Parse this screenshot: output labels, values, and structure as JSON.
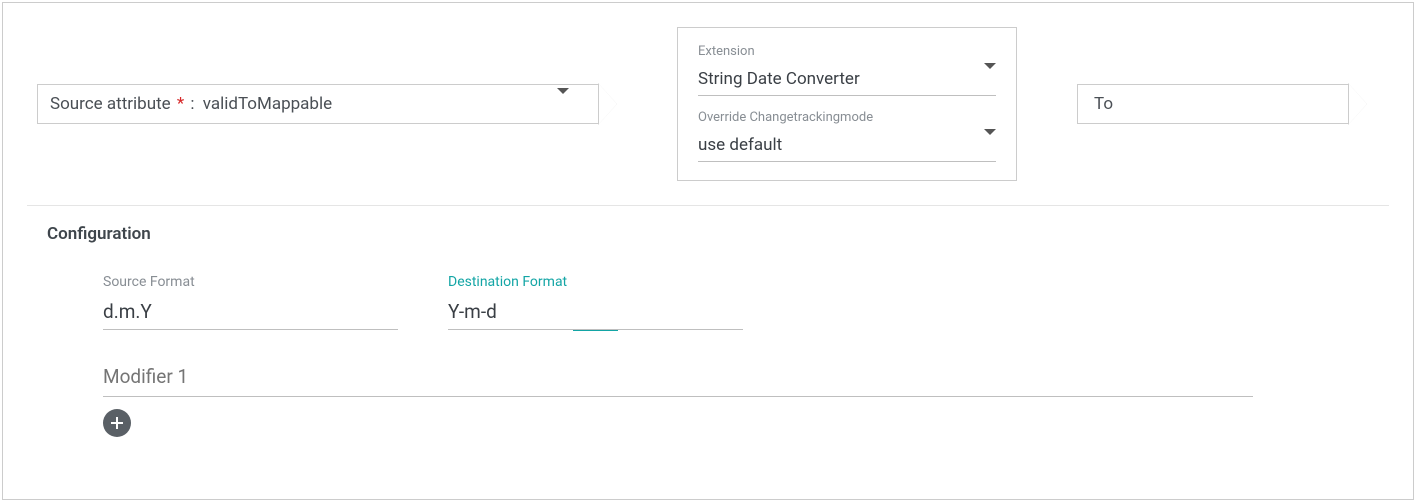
{
  "source": {
    "label": "Source attribute",
    "required_marker": "*",
    "separator": ":",
    "value": "validToMappable"
  },
  "extension_card": {
    "extension_label": "Extension",
    "extension_value": "String Date Converter",
    "override_label": "Override Changetrackingmode",
    "override_value": "use default"
  },
  "destination": {
    "label": "To"
  },
  "config": {
    "title": "Configuration",
    "source_format_label": "Source Format",
    "source_format_value": "d.m.Y",
    "destination_format_label": "Destination Format",
    "destination_format_value": "Y-m-d",
    "modifier_placeholder": "Modifier 1"
  }
}
